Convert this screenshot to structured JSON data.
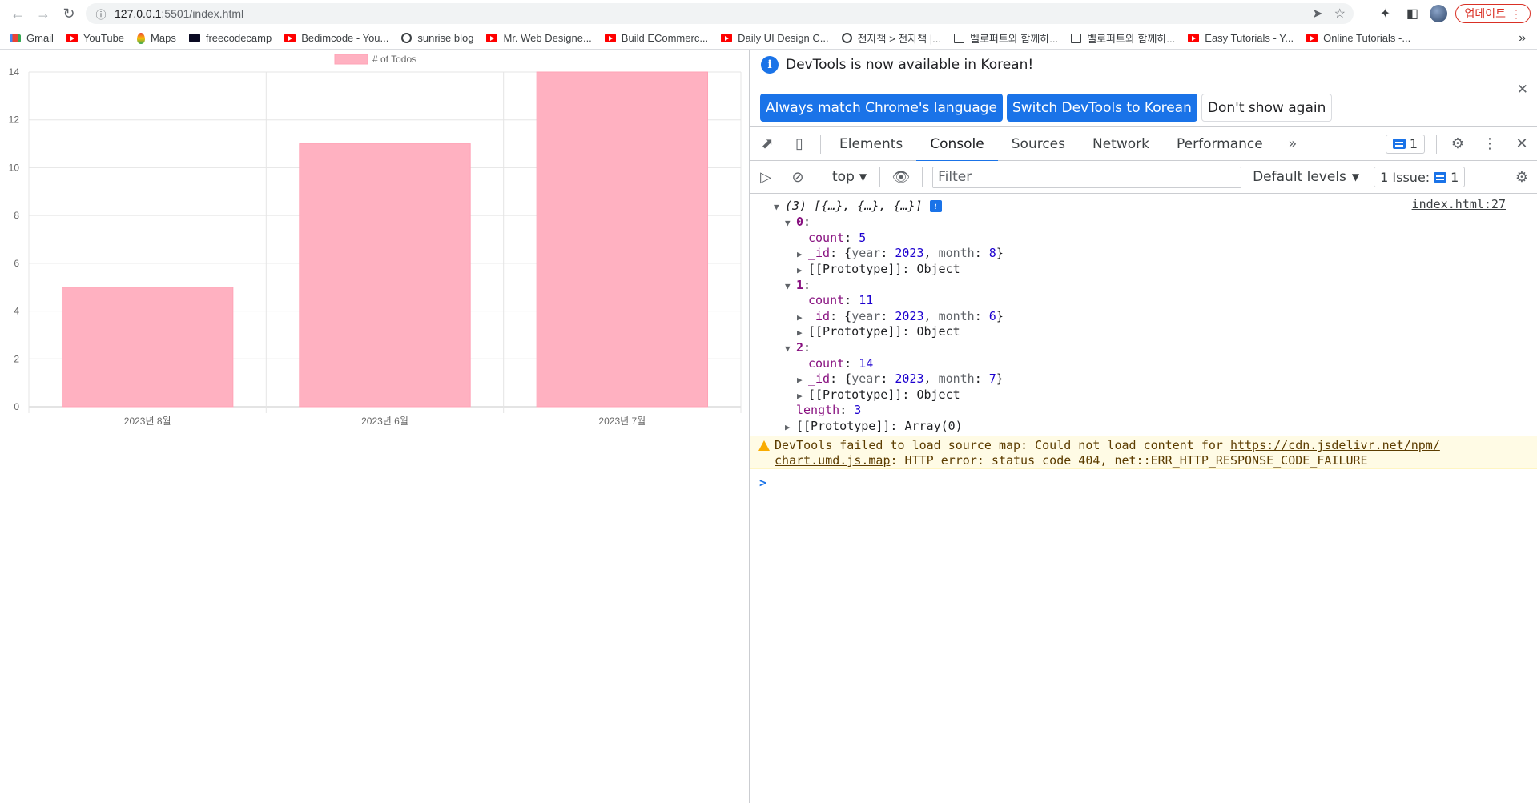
{
  "browser": {
    "url_host": "127.0.0.1",
    "url_path": ":5501/index.html",
    "update_label": "업데이트",
    "bookmarks": [
      {
        "label": "Gmail",
        "icon": "gmail-icon"
      },
      {
        "label": "YouTube",
        "icon": "youtube-icon"
      },
      {
        "label": "Maps",
        "icon": "maps-icon"
      },
      {
        "label": "freecodecamp",
        "icon": "freecodecamp-icon"
      },
      {
        "label": "Bedimcode - You...",
        "icon": "youtube-icon"
      },
      {
        "label": "sunrise blog",
        "icon": "globe-icon"
      },
      {
        "label": "Mr. Web Designe...",
        "icon": "youtube-icon"
      },
      {
        "label": "Build ECommerc...",
        "icon": "youtube-icon"
      },
      {
        "label": "Daily UI Design C...",
        "icon": "youtube-icon"
      },
      {
        "label": "전자책 > 전자책 |...",
        "icon": "globe-icon"
      },
      {
        "label": "벨로퍼트와 함께하...",
        "icon": "book-icon"
      },
      {
        "label": "벨로퍼트와 함께하...",
        "icon": "book-icon"
      },
      {
        "label": "Easy Tutorials - Y...",
        "icon": "youtube-icon"
      },
      {
        "label": "Online Tutorials -...",
        "icon": "youtube-icon"
      }
    ]
  },
  "chart_data": {
    "type": "bar",
    "categories": [
      "2023년 8월",
      "2023년 6월",
      "2023년 7월"
    ],
    "series": [
      {
        "name": "# of Todos",
        "values": [
          5,
          11,
          14
        ]
      }
    ],
    "ylim": [
      0,
      14
    ],
    "yticks": [
      0,
      2,
      4,
      6,
      8,
      10,
      12,
      14
    ],
    "bar_color": "#ffb1c1",
    "grid": true,
    "legend_position": "top"
  },
  "devtools": {
    "infobar": {
      "message": "DevTools is now available in Korean!",
      "btn_match": "Always match Chrome's language",
      "btn_switch": "Switch DevTools to Korean",
      "btn_dismiss": "Don't show again"
    },
    "tabs": [
      "Elements",
      "Console",
      "Sources",
      "Network",
      "Performance"
    ],
    "active_tab": "Console",
    "messages_badge": "1",
    "context": "top",
    "filter_placeholder": "Filter",
    "levels": "Default levels",
    "issues_label": "1 Issue:",
    "issues_count": "1",
    "log": {
      "summary": "(3) [{…}, {…}, {…}]",
      "source": "index.html:27",
      "items": [
        {
          "index": "0",
          "count": "5",
          "year": "2023",
          "month": "8"
        },
        {
          "index": "1",
          "count": "11",
          "year": "2023",
          "month": "6"
        },
        {
          "index": "2",
          "count": "14",
          "year": "2023",
          "month": "7"
        }
      ],
      "proto_object": "[[Prototype]]: Object",
      "length_value": "3",
      "proto_array": "[[Prototype]]: Array(0)"
    },
    "warning": {
      "prefix": "DevTools failed to load source map: Could not load content for ",
      "link1": "https://cdn.jsdelivr.net/npm/",
      "link2": "chart.umd.js.map",
      "suffix": ": HTTP error: status code 404, net::ERR_HTTP_RESPONSE_CODE_FAILURE"
    }
  }
}
